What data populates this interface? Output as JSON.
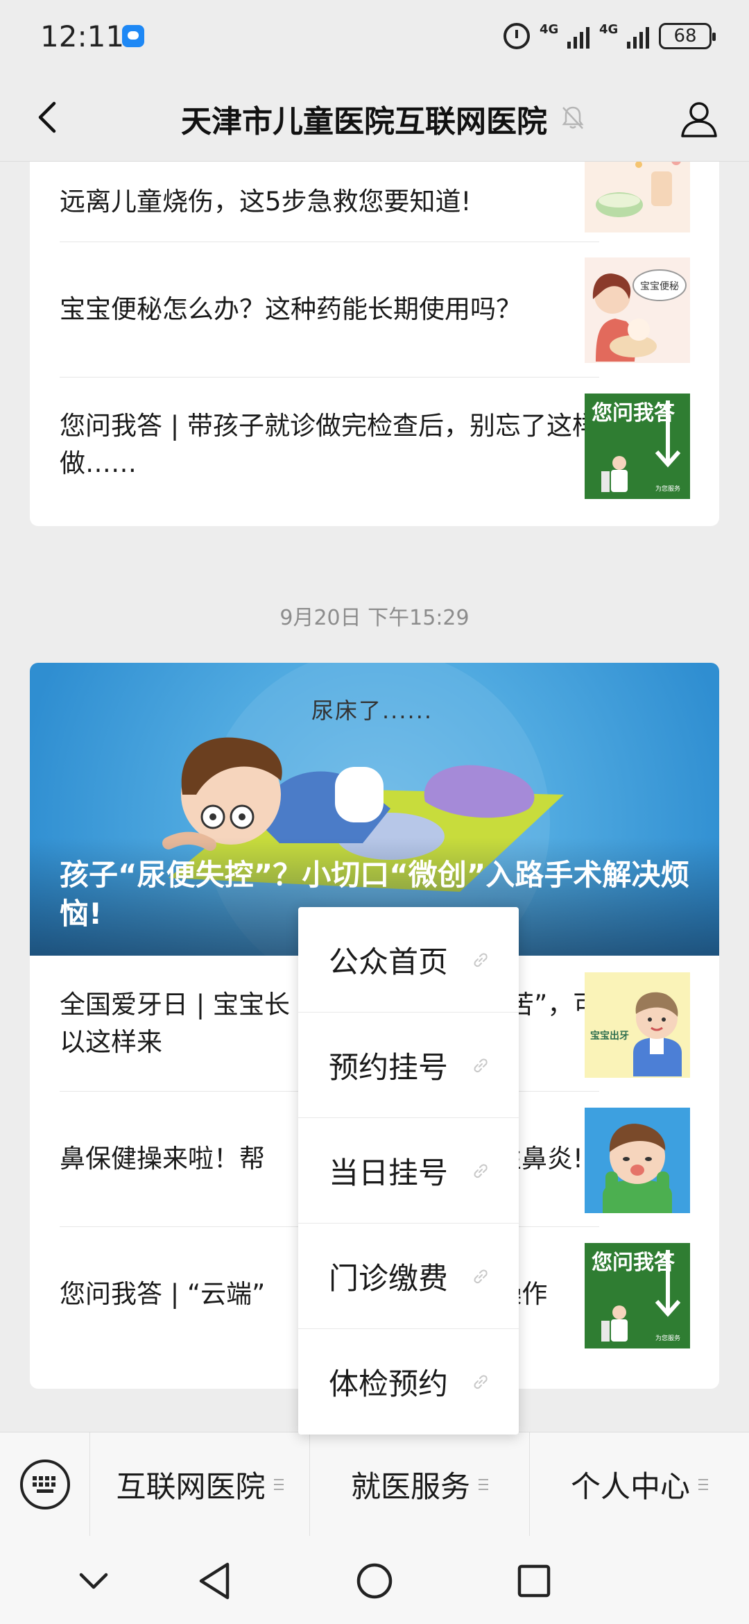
{
  "status_bar": {
    "time": "12:11",
    "network_1": "4G",
    "network_2": "4G",
    "battery": "68"
  },
  "header": {
    "title": "天津市儿童医院互联网医院"
  },
  "card1": {
    "articles": [
      {
        "title": "远离儿童烧伤，这5步急救您要知道!"
      },
      {
        "title": "宝宝便秘怎么办？这种药能长期使用吗？",
        "thumb_text": "宝宝便秘"
      },
      {
        "title": "您问我答 | 带孩子就诊做完检查后，别忘了这样做……",
        "thumb_text": "您问我答",
        "thumb_caption": "为您服务"
      }
    ]
  },
  "timestamp": "9月20日 下午15:29",
  "card2": {
    "banner_caption": "尿床了......",
    "banner_title": "孩子“尿便失控”？小切口“微创”入路手术解决烦恼!",
    "articles": [
      {
        "title": "全国爱牙日 | 宝宝长　　　　　　　“痛苦”，可以这样来",
        "thumb_text": "宝宝出牙"
      },
      {
        "title": "鼻保健操来啦！帮　　　　　　　过敏性鼻炎!"
      },
      {
        "title": "您问我答 | “云端”　　　　　　剂这样操作",
        "thumb_text": "您问我答",
        "thumb_caption": "为您服务"
      }
    ]
  },
  "popup_menu": {
    "items": [
      "公众首页",
      "预约挂号",
      "当日挂号",
      "门诊缴费",
      "体检预约"
    ]
  },
  "menubar": {
    "tabs": [
      "互联网医院",
      "就医服务",
      "个人中心"
    ]
  },
  "colors": {
    "background": "#ededed",
    "thumb_green": "#2f7d32",
    "banner_blue": "#3a9ad9"
  }
}
